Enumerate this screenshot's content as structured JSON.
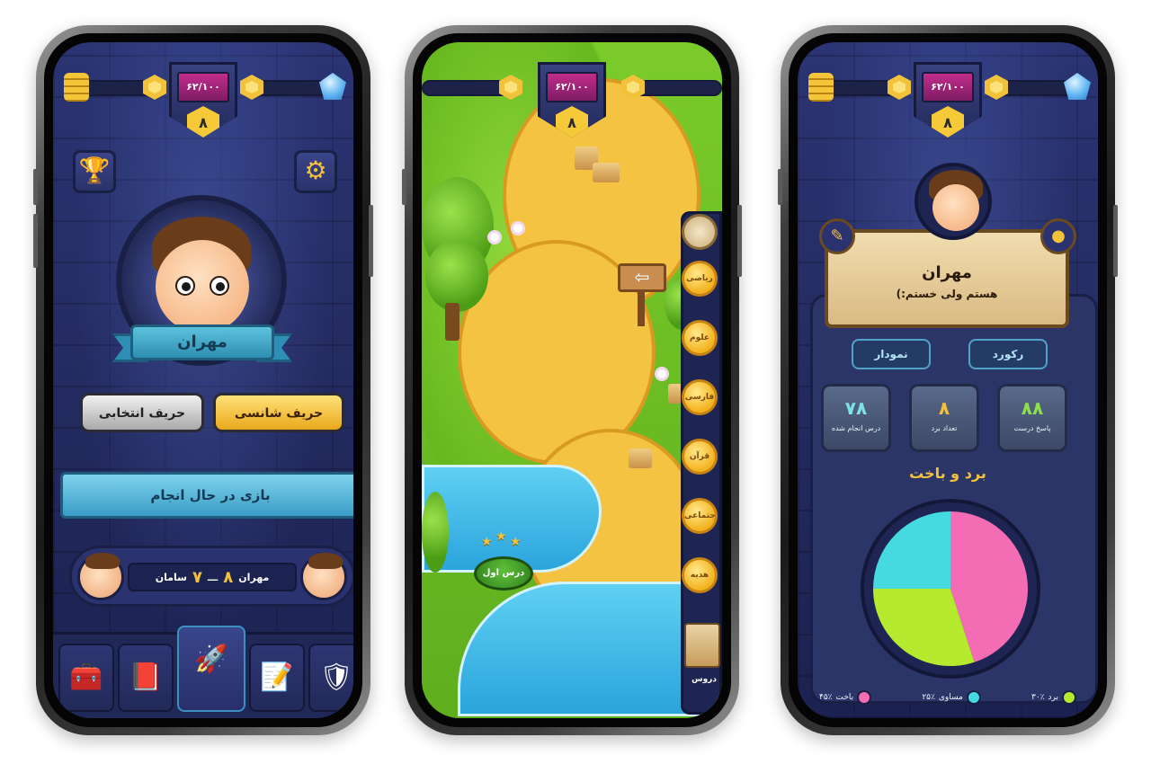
{
  "hud": {
    "progress_text": "۶۲/۱۰۰",
    "level": "۸"
  },
  "home": {
    "player_name": "مهران",
    "buttons": {
      "random_opponent": "حریف شانسی",
      "chosen_opponent": "حریف انتخابی"
    },
    "ongoing_games_title": "بازی در حال انجام",
    "match": {
      "player1": "مهران",
      "score1": "۸",
      "separator": "ـــ",
      "score2": "۷",
      "player2": "سامان"
    },
    "nav_icons": [
      "chest-icon",
      "book-icon",
      "rocket-icon",
      "paper-pencil-icon",
      "profile-shield-icon"
    ]
  },
  "map": {
    "lesson_node_label": "درس اول",
    "lesson_stars": 3,
    "level_labels": [
      "ریاضی",
      "علوم",
      "فارسی",
      "قرآن",
      "اجتماعی",
      "هدیه",
      "علوم"
    ],
    "rail_label": "دروس"
  },
  "profile": {
    "name": "مهران",
    "bio": "(:هستم ولی خستم",
    "tabs": {
      "record": "رکورد",
      "chart": "نمودار"
    },
    "stats": [
      {
        "value": "۸۸",
        "label": "پاسخ درست",
        "color": "green"
      },
      {
        "value": "۸",
        "label": "تعداد برد",
        "color": "yellow"
      },
      {
        "value": "۷۸",
        "label": "درس انجام شده",
        "color": "cyan"
      }
    ],
    "chart_title": "برد و باخت"
  },
  "chart_data": {
    "type": "pie",
    "title": "برد و باخت",
    "slices": [
      {
        "label": "برد",
        "value": 30,
        "value_text": "۳۰٪",
        "color": "#b5ea2f"
      },
      {
        "label": "مساوی",
        "value": 25,
        "value_text": "۲۵٪",
        "color": "#45d9e0"
      },
      {
        "label": "باخت",
        "value": 45,
        "value_text": "۴۵٪",
        "color": "#f36cb4"
      }
    ]
  }
}
